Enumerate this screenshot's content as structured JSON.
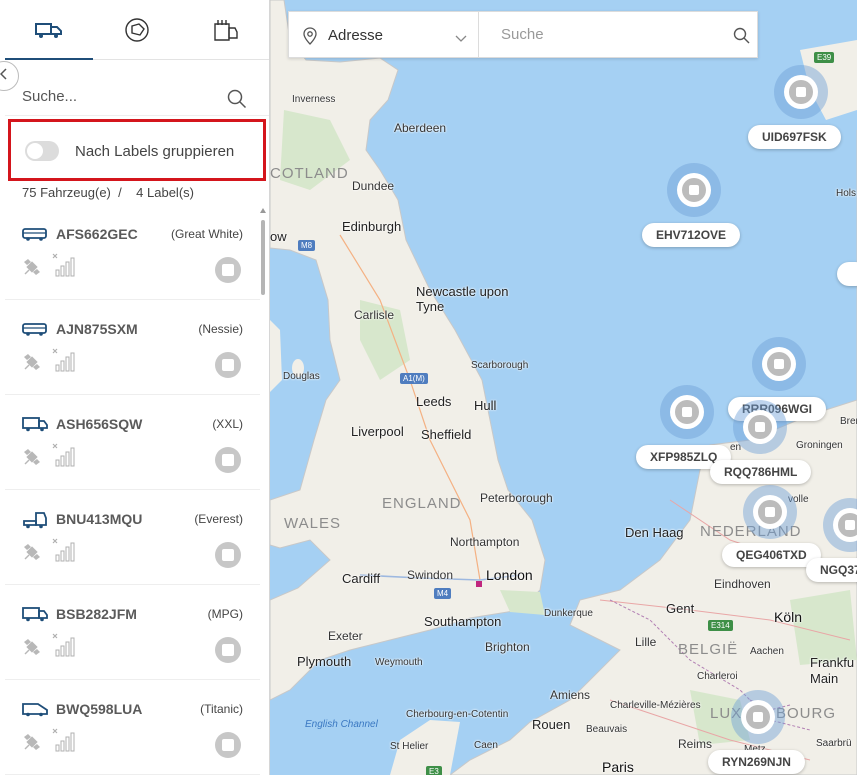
{
  "sidebar": {
    "tabs": [
      {
        "icon": "truck-icon"
      },
      {
        "icon": "polygon-icon"
      },
      {
        "icon": "cargo-tag-icon"
      }
    ],
    "search_placeholder": "Suche...",
    "group_toggle_label": "Nach Labels gruppieren",
    "counts_text": "75 Fahrzeug(e)  /    4 Label(s)",
    "vehicles": [
      {
        "plate": "AFS662GEC",
        "label": "(Great White)",
        "type": "bus"
      },
      {
        "plate": "AJN875SXM",
        "label": "(Nessie)",
        "type": "bus"
      },
      {
        "plate": "ASH656SQW",
        "label": "(XXL)",
        "type": "truck"
      },
      {
        "plate": "BNU413MQU",
        "label": "(Everest)",
        "type": "tractor"
      },
      {
        "plate": "BSB282JFM",
        "label": "(MPG)",
        "type": "truck"
      },
      {
        "plate": "BWQ598LUA",
        "label": "(Titanic)",
        "type": "van"
      }
    ]
  },
  "address_bar": {
    "type_label": "Adresse",
    "search_placeholder": "Suche"
  },
  "map": {
    "markers": [
      "UID697FSK",
      "EHV712OVE",
      "RRR096WGI",
      "XFP985ZLQ",
      "RQQ786HML",
      "QEG406TXD",
      "NGQ37",
      "RYN269NJN"
    ],
    "labels": {
      "inverness": "Inverness",
      "aberdeen": "Aberdeen",
      "scotland": "COTLAND",
      "dundee": "Dundee",
      "edinburgh": "Edinburgh",
      "glasgow": "ow",
      "newcastle1": "Newcastle upon",
      "newcastle2": "Tyne",
      "carlisle": "Carlisle",
      "douglas": "Douglas",
      "scarborough": "Scarborough",
      "leeds": "Leeds",
      "hull": "Hull",
      "liverpool": "Liverpool",
      "sheffield": "Sheffield",
      "england": "ENGLAND",
      "wales": "WALES",
      "peterborough": "Peterborough",
      "northampton": "Northampton",
      "cardiff": "Cardiff",
      "swindon": "Swindon",
      "london": "London",
      "southampton": "Southampton",
      "dunkerque": "Dunkerque",
      "exeter": "Exeter",
      "brighton": "Brighton",
      "plymouth": "Plymouth",
      "weymouth": "Weymouth",
      "english_channel": "English Channel",
      "den_haag": "Den Haag",
      "nederland": "NEDERLAND",
      "eindhoven": "Eindhoven",
      "gent": "Gent",
      "lille": "Lille",
      "koeln": "Köln",
      "belgie": "BELGIË",
      "aachen": "Aachen",
      "frankfurt1": "Frankfu",
      "frankfurt2": "Main",
      "charleroi": "Charleroi",
      "amiens": "Amiens",
      "charleville": "Charleville-Mézières",
      "rouen": "Rouen",
      "cherbourg": "Cherbourg-en-Cotentin",
      "beauvais": "Beauvais",
      "luxembourg": "LUX",
      "luxembourg2": "BOURG",
      "st_helier": "St Helier",
      "caen": "Caen",
      "reims": "Reims",
      "paris": "Paris",
      "metz": "Metz",
      "saarbruecken": "Saarbrü",
      "groningen": "Groningen",
      "bremerh": "Bremerh",
      "holst": "Hols",
      "en": "en",
      "volle": "volle"
    },
    "shields": {
      "m8": "M8",
      "a1m": "A1(M)",
      "m4": "M4",
      "e39": "E39",
      "e314": "E314",
      "e3": "E3"
    }
  }
}
